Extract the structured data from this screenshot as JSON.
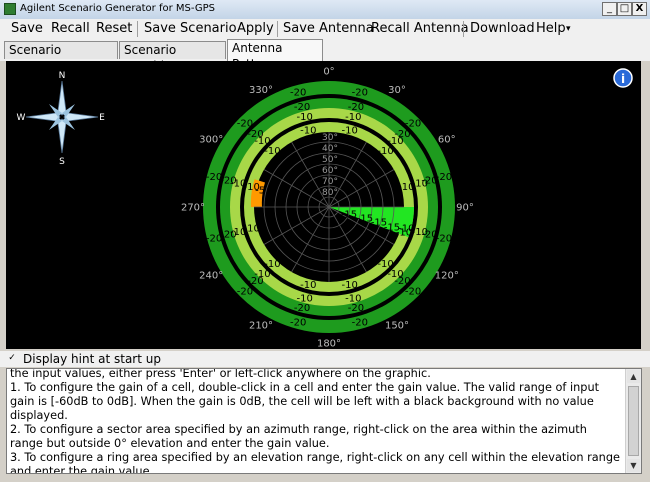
{
  "window": {
    "title": "Agilent Scenario Generator for MS-GPS",
    "min_glyph": "_",
    "max_glyph": "□",
    "close_glyph": "X"
  },
  "menu": {
    "save": "Save",
    "recall": "Recall",
    "reset": "Reset",
    "save_scenario": "Save Scenario",
    "apply": "Apply",
    "save_antenna": "Save Antenna",
    "recall_antenna": "Recall Antenna",
    "download": "Download",
    "help": "Help",
    "help_arrow": "▾"
  },
  "tabs": {
    "generator": "Scenario Generator",
    "graphics": "Scenario Graphics",
    "antenna": "Antenna Pattern"
  },
  "compass": {
    "n": "N",
    "s": "S",
    "e": "E",
    "w": "W"
  },
  "info_icon": "i",
  "pattern": {
    "outer_ring_values": [
      "-20",
      "-20",
      "-20",
      "-20",
      "-20",
      "-20",
      "-20",
      "-20",
      "-20",
      "-20",
      "-20",
      "-20"
    ],
    "mid_ring_values": [
      "-20",
      "-20",
      "-20",
      "-20",
      "-20",
      "-20",
      "-20",
      "-20",
      "-20",
      "-20",
      "-20",
      "-20"
    ],
    "ring3_values": [
      "-10",
      "-10",
      "-10",
      "-10",
      "-10",
      "-10",
      "-10",
      "-10",
      "-10",
      "-10",
      "-10",
      "-10"
    ],
    "ring4_values": [
      "-10",
      "-10",
      "-10",
      "-10",
      "-10",
      "-10",
      "-10",
      "-10",
      "-10",
      "-10",
      "-10",
      "-10"
    ],
    "orange_value": "-5",
    "sector_values": [
      "-15",
      "-15",
      "-15",
      "-15",
      "-10"
    ],
    "elev_labels": [
      "30°",
      "40°",
      "50°",
      "60°",
      "70°",
      "80°"
    ],
    "az_labels": [
      "0°",
      "30°",
      "60°",
      "90°",
      "120°",
      "150°",
      "180°",
      "210°",
      "240°",
      "270°",
      "300°",
      "330°"
    ],
    "colors": {
      "outer": "#1e9b1e",
      "light": "#a8d848",
      "orange": "#ff9900",
      "bright": "#22e622"
    }
  },
  "hint": {
    "checkbox_mark": "✓",
    "label": "Display hint at start up",
    "text": "the input values, either press 'Enter' or left-click anywhere on the graphic.\n1. To configure the gain of a cell, double-click in a cell and enter the gain value. The valid range of input gain is [-60dB to 0dB]. When the gain is 0dB, the cell will be left with a black background with no value displayed.\n2. To configure a sector area specified by an azimuth range, right-click on the area within the azimuth range but outside 0° elevation and enter the gain value.\n3. To configure a ring area specified by an elevation range, right-click on any cell within the elevation range and enter the gain value."
  },
  "scroll": {
    "up": "▲",
    "down": "▼"
  }
}
